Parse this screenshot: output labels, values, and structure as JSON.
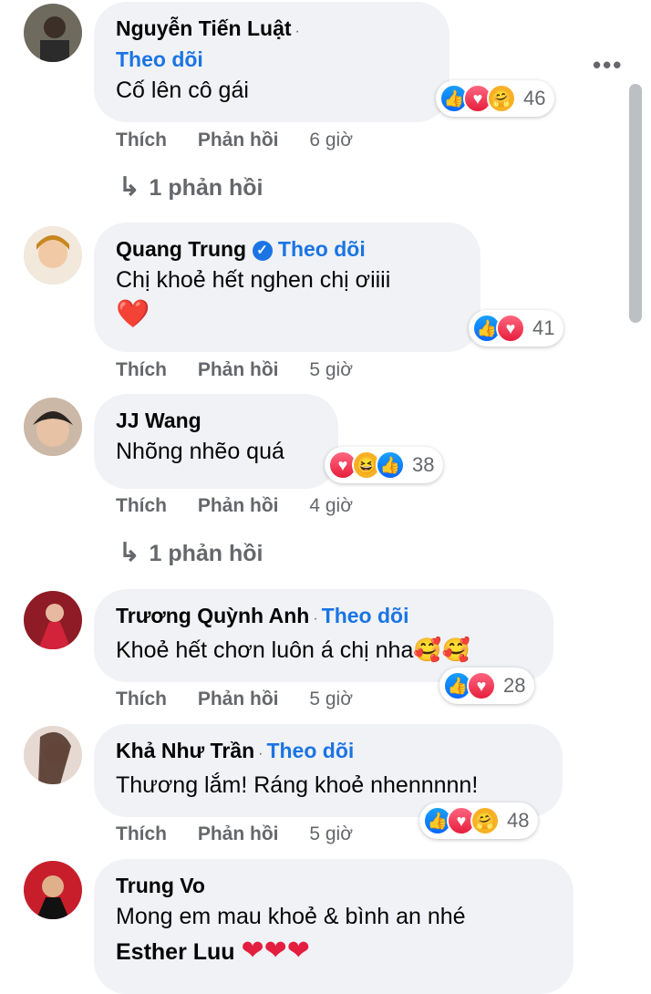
{
  "comments": [
    {
      "name": "Nguyễn Tiến Luật",
      "follow": "Theo dõi",
      "text": "Cố lên cô gái",
      "like_label": "Thích",
      "reply_label": "Phản hồi",
      "time": "6 giờ",
      "reaction_count": "46",
      "replies": "1 phản hồi"
    },
    {
      "name": "Quang Trung",
      "follow": "Theo dõi",
      "text": "Chị khoẻ hết nghen chị ơiiii",
      "emoji": "❤️",
      "like_label": "Thích",
      "reply_label": "Phản hồi",
      "time": "5 giờ",
      "reaction_count": "41"
    },
    {
      "name": "JJ Wang",
      "text": "Nhõng nhẽo quá",
      "like_label": "Thích",
      "reply_label": "Phản hồi",
      "time": "4 giờ",
      "reaction_count": "38",
      "replies": "1 phản hồi"
    },
    {
      "name": "Trương Quỳnh Anh",
      "follow": "Theo dõi",
      "text": "Khoẻ hết chơn luôn á chị nha🥰🥰",
      "like_label": "Thích",
      "reply_label": "Phản hồi",
      "time": "5 giờ",
      "reaction_count": "28"
    },
    {
      "name": "Khả Như Trần",
      "follow": "Theo dõi",
      "text": "Thương lắm! Ráng khoẻ nhennnnn!",
      "like_label": "Thích",
      "reply_label": "Phản hồi",
      "time": "5 giờ",
      "reaction_count": "48"
    },
    {
      "name": "Trung Vo",
      "text": "Mong em mau khoẻ & bình an nhé",
      "mention": "Esther Luu",
      "hearts": "❤❤❤"
    }
  ],
  "icons": {
    "more": "more-options-icon",
    "like": "like-icon",
    "love": "love-icon",
    "care": "care-icon",
    "haha": "haha-icon",
    "verified": "verified-badge-icon",
    "reply_arrow": "reply-arrow-icon"
  },
  "colors": {
    "link": "#1b74e4",
    "bubble": "#f0f2f5",
    "muted": "#65676b",
    "like": "#0866ff",
    "love": "#e61e3c"
  }
}
